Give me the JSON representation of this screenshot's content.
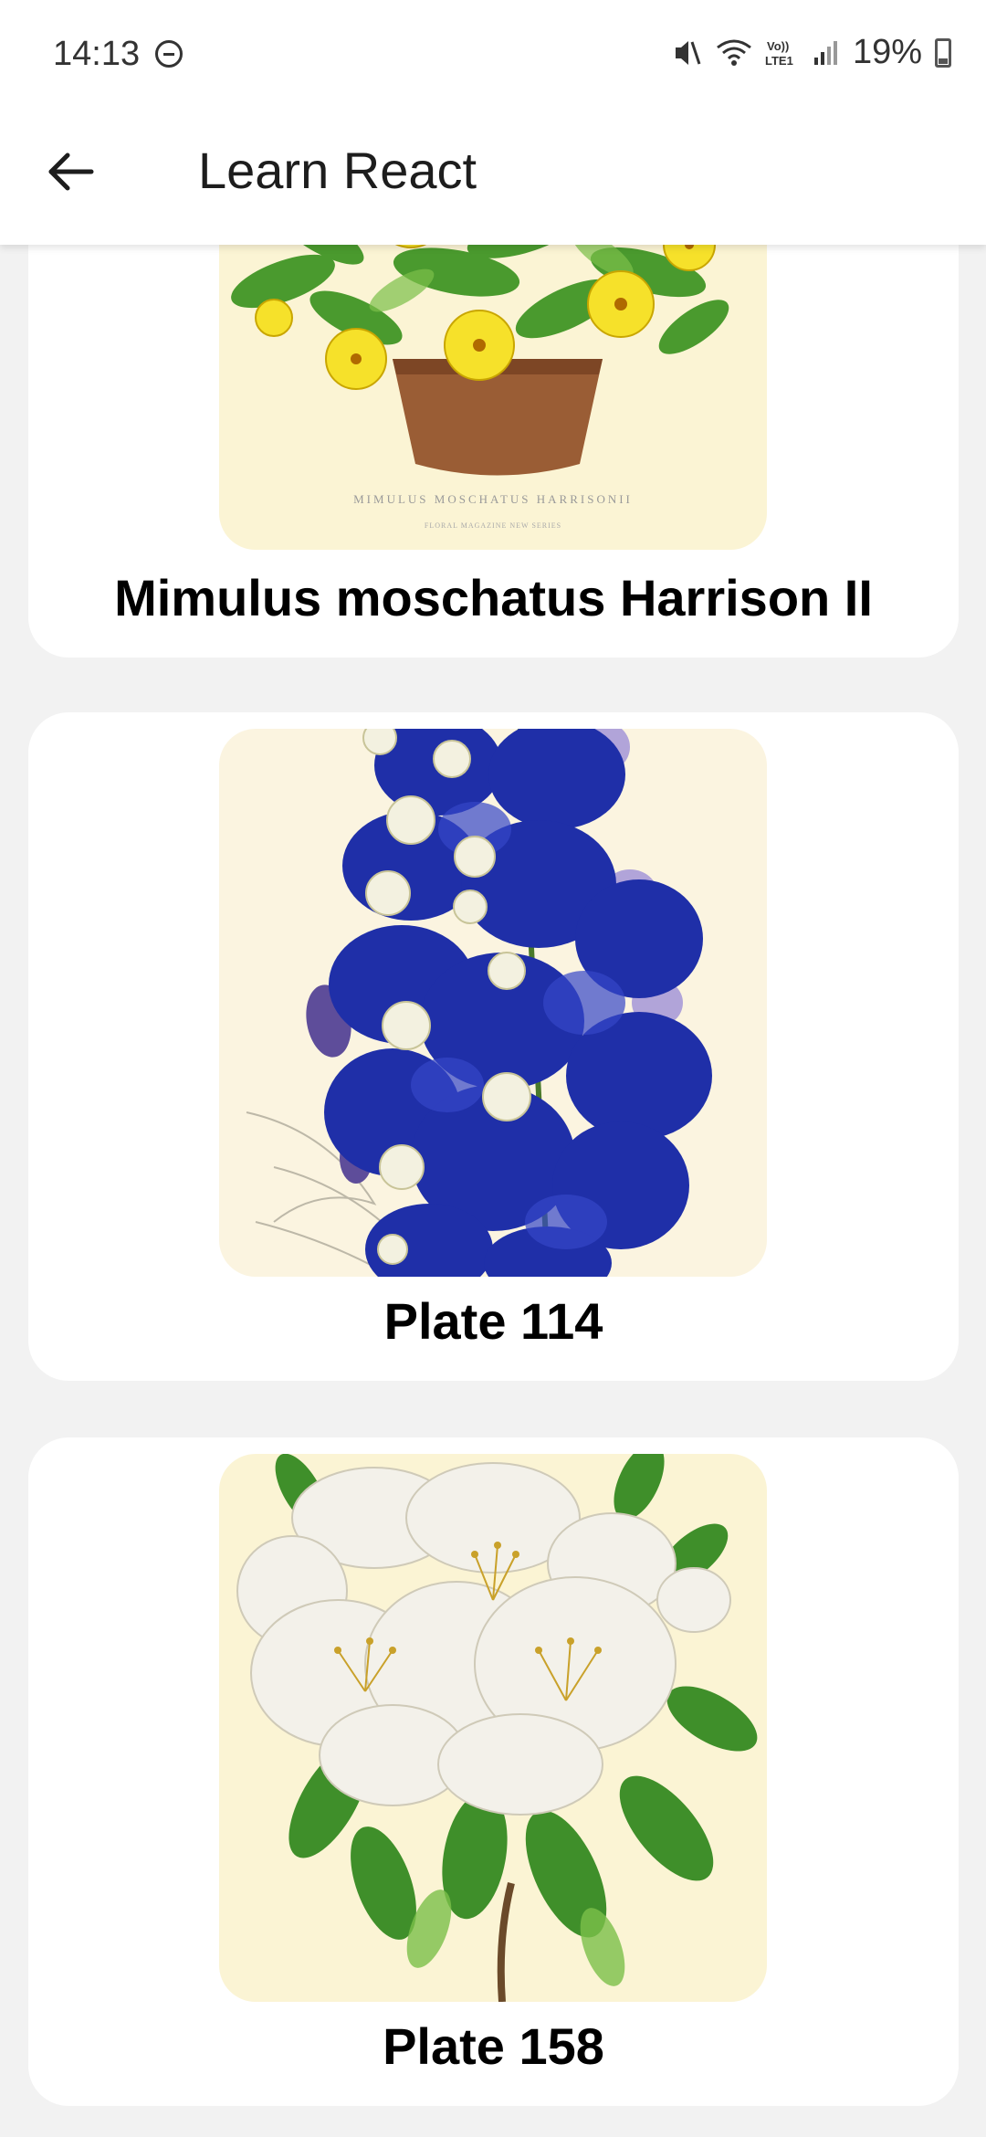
{
  "status_bar": {
    "time": "14:13",
    "battery": "19%",
    "icons": [
      "do-not-disturb-icon",
      "mute-icon",
      "wifi-icon",
      "volte-icon",
      "signal-icon",
      "battery-icon"
    ],
    "volte_label": "Vo)) LTE1"
  },
  "app_bar": {
    "title": "Learn React",
    "back_icon": "arrow-left-icon"
  },
  "colors": {
    "background": "#f2f2f2",
    "card": "#ffffff",
    "plate_paper": "#fbf4d4",
    "yellow_flower": "#f6e12a",
    "blue_flower": "#1f2fa8",
    "white_flower": "#f3f1ea",
    "leaf_green": "#3f8f2a"
  },
  "cards": [
    {
      "caption": "Mimulus moschatus Harrison II",
      "plate_text": "MIMULUS MOSCHATUS HARRISONII",
      "plate_subtext": "FLORAL MAGAZINE NEW SERIES"
    },
    {
      "caption": "Plate 114"
    },
    {
      "caption": "Plate 158"
    }
  ]
}
